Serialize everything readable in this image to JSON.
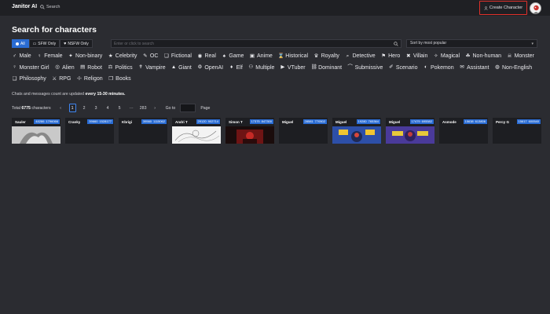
{
  "header": {
    "logo": "Janitor AI",
    "search_label": "Search",
    "create_label": "Create Character"
  },
  "page_title": "Search for characters",
  "filters": {
    "segments": [
      {
        "label": "All",
        "active": true,
        "icon": "dot-icon"
      },
      {
        "label": "SFW Only",
        "active": false,
        "icon": "chat-icon"
      },
      {
        "label": "NSFW Only",
        "active": false,
        "icon": "heart-icon"
      }
    ],
    "search_placeholder": "Enter or click to search",
    "sort_value": "Sort by most popular"
  },
  "tags": [
    {
      "label": "Male",
      "icon": "♂"
    },
    {
      "label": "Female",
      "icon": "♀"
    },
    {
      "label": "Non-binary",
      "icon": "✦"
    },
    {
      "label": "Celebrity",
      "icon": "★"
    },
    {
      "label": "OC",
      "icon": "✎"
    },
    {
      "label": "Fictional",
      "icon": "❏"
    },
    {
      "label": "Real",
      "icon": "◉"
    },
    {
      "label": "Game",
      "icon": "♠"
    },
    {
      "label": "Anime",
      "icon": "▣"
    },
    {
      "label": "Historical",
      "icon": "⌛"
    },
    {
      "label": "Royalty",
      "icon": "♛"
    },
    {
      "label": "Detective",
      "icon": "⌕"
    },
    {
      "label": "Hero",
      "icon": "⚑"
    },
    {
      "label": "Villain",
      "icon": "✖"
    },
    {
      "label": "Magical",
      "icon": "✧"
    },
    {
      "label": "Non-human",
      "icon": "☘"
    },
    {
      "label": "Monster",
      "icon": "☠"
    },
    {
      "label": "Monster Girl",
      "icon": "♀"
    },
    {
      "label": "Alien",
      "icon": "◎"
    },
    {
      "label": "Robot",
      "icon": "▤"
    },
    {
      "label": "Politics",
      "icon": "⚖"
    },
    {
      "label": "Vampire",
      "icon": "✝"
    },
    {
      "label": "Giant",
      "icon": "▲"
    },
    {
      "label": "OpenAI",
      "icon": "⚙"
    },
    {
      "label": "Elf",
      "icon": "♦"
    },
    {
      "label": "Multiple",
      "icon": "⚇"
    },
    {
      "label": "VTuber",
      "icon": "▶"
    },
    {
      "label": "Dominant",
      "icon": "⛓"
    },
    {
      "label": "Submissive",
      "icon": "⌒"
    },
    {
      "label": "Scenario",
      "icon": "✐"
    },
    {
      "label": "Pokemon",
      "icon": "◐"
    },
    {
      "label": "Assistant",
      "icon": "✉"
    },
    {
      "label": "Non-English",
      "icon": "◍"
    },
    {
      "label": "Philosophy",
      "icon": "❑"
    },
    {
      "label": "RPG",
      "icon": "⚔"
    },
    {
      "label": "Religon",
      "icon": "☩"
    },
    {
      "label": "Books",
      "icon": "❒"
    }
  ],
  "notice": {
    "prefix": "Chats and messages count are updated ",
    "bold": "every 15-30 minutes."
  },
  "pagination": {
    "total_prefix": "Total ",
    "total_count": "6775",
    "total_suffix": " characters",
    "prev": "‹",
    "pages": [
      "1",
      "2",
      "3",
      "4",
      "5"
    ],
    "ellipsis": "···",
    "last": "283",
    "next": "›",
    "goto_label": "Go to",
    "page_label": "Page"
  },
  "cards": [
    {
      "name": "Sauler",
      "chats": "48286",
      "messages": "1796066",
      "thumb": "gray"
    },
    {
      "name": "Cranky",
      "chats": "39660",
      "messages": "1528177",
      "thumb": "dark"
    },
    {
      "name": "Kbrigi",
      "chats": "39560",
      "messages": "1115062",
      "thumb": "dark"
    },
    {
      "name": "Andri T",
      "chats": "29120",
      "messages": "902714",
      "thumb": "sketch"
    },
    {
      "name": "Simon T",
      "chats": "17375",
      "messages": "847300",
      "thumb": "red"
    },
    {
      "name": "Miguel",
      "chats": "28581",
      "messages": "770502",
      "thumb": "dark"
    },
    {
      "name": "Miguel",
      "chats": "19280",
      "messages": "765364",
      "thumb": "blue"
    },
    {
      "name": "Miguel",
      "chats": "17479",
      "messages": "695582",
      "thumb": "purple"
    },
    {
      "name": "Asmode",
      "chats": "15638",
      "messages": "613806",
      "thumb": "dark"
    },
    {
      "name": "Percy G",
      "chats": "15617",
      "messages": "600540",
      "thumb": "dark"
    }
  ]
}
